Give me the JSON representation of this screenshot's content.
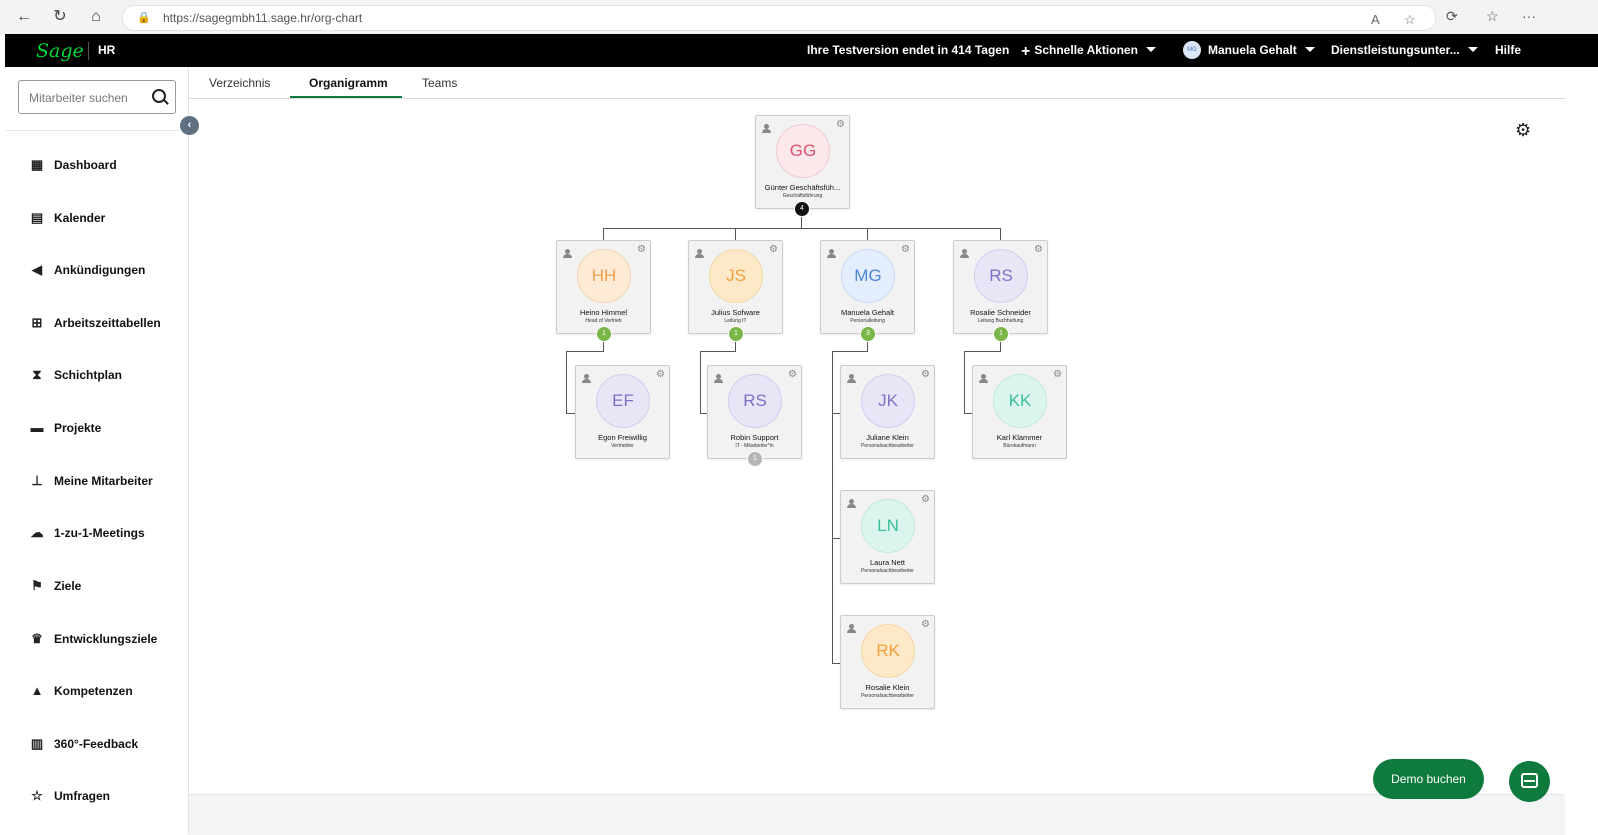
{
  "browser": {
    "url": "https://sagegmbh11.sage.hr/org-chart"
  },
  "topbar": {
    "logo": "Sage",
    "product": "HR",
    "trial": "Ihre Testversion endet in 414 Tagen",
    "quick_actions": "Schnelle Aktionen",
    "user_initials": "MG",
    "user_name": "Manuela Gehalt",
    "company": "Dienstleistungsunter...",
    "help": "Hilfe"
  },
  "sidebar": {
    "search_placeholder": "Mitarbeiter suchen",
    "items": [
      {
        "label": "Dashboard",
        "icon": "dashboard-icon"
      },
      {
        "label": "Kalender",
        "icon": "calendar-icon"
      },
      {
        "label": "Ankündigungen",
        "icon": "megaphone-icon"
      },
      {
        "label": "Arbeitszeittabellen",
        "icon": "table-icon"
      },
      {
        "label": "Schichtplan",
        "icon": "hourglass-icon"
      },
      {
        "label": "Projekte",
        "icon": "briefcase-icon"
      },
      {
        "label": "Meine Mitarbeiter",
        "icon": "sitemap-icon"
      },
      {
        "label": "1-zu-1-Meetings",
        "icon": "chat-bubbles-icon"
      },
      {
        "label": "Ziele",
        "icon": "flag-icon"
      },
      {
        "label": "Entwicklungsziele",
        "icon": "trophy-icon"
      },
      {
        "label": "Kompetenzen",
        "icon": "graduation-cap-icon"
      },
      {
        "label": "360°-Feedback",
        "icon": "building-icon"
      },
      {
        "label": "Umfragen",
        "icon": "star-icon"
      }
    ]
  },
  "tabs": [
    {
      "label": "Verzeichnis",
      "active": false
    },
    {
      "label": "Organigramm",
      "active": true
    },
    {
      "label": "Teams",
      "active": false
    }
  ],
  "org": {
    "root": {
      "initials": "GG",
      "name": "Günter Geschäftsfüh...",
      "role": "Geschäftsführung",
      "reports": "4"
    },
    "managers": [
      {
        "initials": "HH",
        "name": "Heino Himmel",
        "role": "Head of Vertrieb",
        "reports": "1"
      },
      {
        "initials": "JS",
        "name": "Julius Sofware",
        "role": "Leitung IT",
        "reports": "1"
      },
      {
        "initials": "MG",
        "name": "Manuela Gehalt",
        "role": "Personalleitung",
        "reports": "3"
      },
      {
        "initials": "RS",
        "name": "Rosalie Schneider",
        "role": "Leitung Buchhaltung",
        "reports": "1"
      }
    ],
    "staff": [
      {
        "initials": "EF",
        "name": "Egon Freiwillig",
        "role": "Vertriebler"
      },
      {
        "initials": "RS",
        "name": "Robin Support",
        "role": "IT - Mitarbeiter*in",
        "reports": "1"
      },
      {
        "initials": "JK",
        "name": "Juliane Klein",
        "role": "Personalsachbearbeiter"
      },
      {
        "initials": "KK",
        "name": "Karl Klammer",
        "role": "Bürokaufmann"
      },
      {
        "initials": "LN",
        "name": "Laura Nett",
        "role": "Personalsachbearbeiter"
      },
      {
        "initials": "RK",
        "name": "Rosalie Klein",
        "role": "Personalsachbearbeiter"
      }
    ]
  },
  "buttons": {
    "demo": "Demo buchen"
  },
  "colors": {
    "brand_green": "#0f7a3d",
    "logo_green": "#00d639",
    "count_green": "#7ab648"
  }
}
